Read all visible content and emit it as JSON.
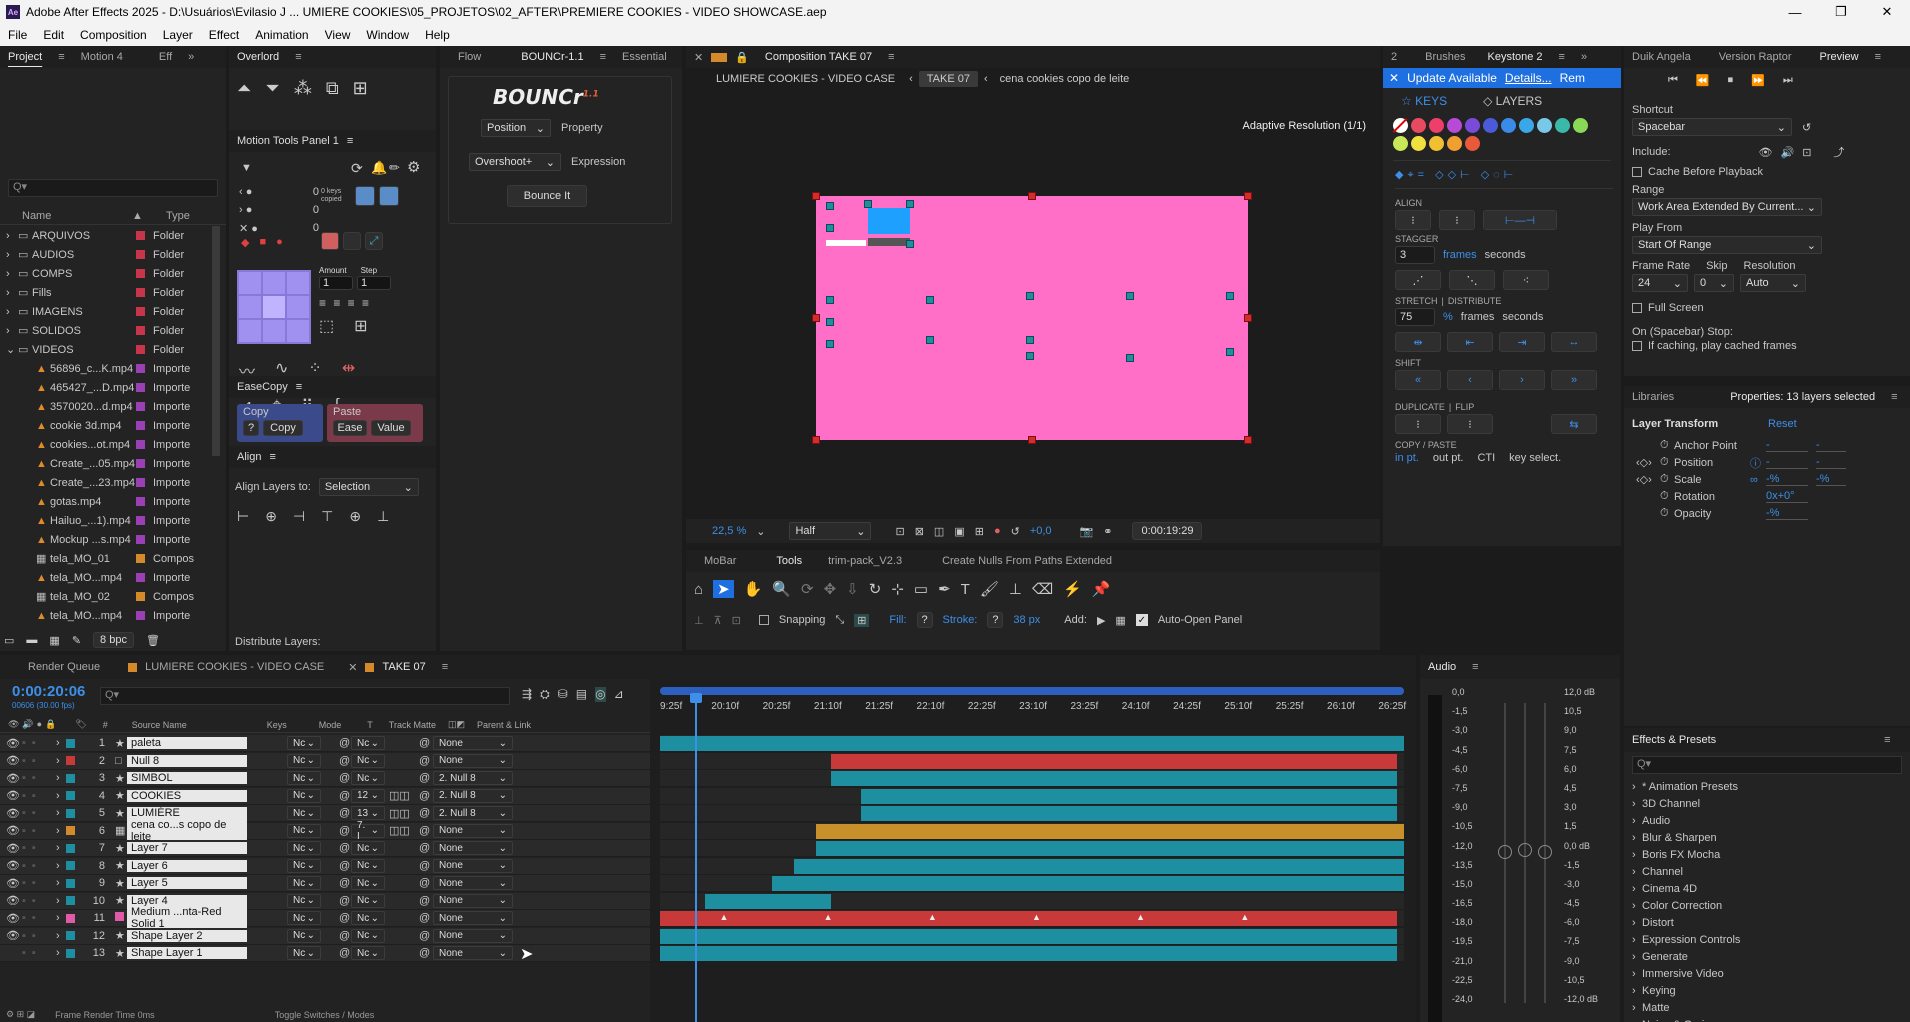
{
  "window": {
    "title": "Adobe After Effects 2025 - D:\\Usuários\\Evilasio J ... UMIERE COOKIES\\05_PROJETOS\\02_AFTER\\PREMIERE COOKIES - VIDEO SHOWCASE.aep",
    "app_badge": "Ae",
    "min": "—",
    "max": "❐",
    "close": "✕"
  },
  "menu": [
    "File",
    "Edit",
    "Composition",
    "Layer",
    "Effect",
    "Animation",
    "View",
    "Window",
    "Help"
  ],
  "project": {
    "tabs": [
      "Project",
      "Motion 4",
      "Eff"
    ],
    "search_placeholder": "Q▾",
    "columns": {
      "name": "Name",
      "type": "Type"
    },
    "bpc": "8 bpc",
    "items": [
      {
        "name": "ARQUIVOS",
        "type": "Folder",
        "color": "#c8344a",
        "kind": "folder"
      },
      {
        "name": "AUDIOS",
        "type": "Folder",
        "color": "#c8344a",
        "kind": "folder"
      },
      {
        "name": "COMPS",
        "type": "Folder",
        "color": "#c8344a",
        "kind": "folder"
      },
      {
        "name": "Fills",
        "type": "Folder",
        "color": "#c8344a",
        "kind": "folder"
      },
      {
        "name": "IMAGENS",
        "type": "Folder",
        "color": "#c8344a",
        "kind": "folder"
      },
      {
        "name": "SOLIDOS",
        "type": "Folder",
        "color": "#c8344a",
        "kind": "folder"
      },
      {
        "name": "VIDEOS",
        "type": "Folder",
        "color": "#c8344a",
        "kind": "folder-open"
      },
      {
        "name": "56896_c...K.mp4",
        "type": "Importe",
        "color": "#9b3fb5",
        "kind": "file"
      },
      {
        "name": "465427_...D.mp4",
        "type": "Importe",
        "color": "#9b3fb5",
        "kind": "file"
      },
      {
        "name": "3570020...d.mp4",
        "type": "Importe",
        "color": "#9b3fb5",
        "kind": "file"
      },
      {
        "name": "cookie 3d.mp4",
        "type": "Importe",
        "color": "#9b3fb5",
        "kind": "file"
      },
      {
        "name": "cookies...ot.mp4",
        "type": "Importe",
        "color": "#9b3fb5",
        "kind": "file"
      },
      {
        "name": "Create_...05.mp4",
        "type": "Importe",
        "color": "#9b3fb5",
        "kind": "file"
      },
      {
        "name": "Create_...23.mp4",
        "type": "Importe",
        "color": "#9b3fb5",
        "kind": "file"
      },
      {
        "name": "gotas.mp4",
        "type": "Importe",
        "color": "#9b3fb5",
        "kind": "file"
      },
      {
        "name": "Hailuo_...1).mp4",
        "type": "Importe",
        "color": "#9b3fb5",
        "kind": "file"
      },
      {
        "name": "Mockup ...s.mp4",
        "type": "Importe",
        "color": "#9b3fb5",
        "kind": "file"
      },
      {
        "name": "tela_MO_01",
        "type": "Compos",
        "color": "#d48a2a",
        "kind": "comp"
      },
      {
        "name": "tela_MO...mp4",
        "type": "Importe",
        "color": "#9b3fb5",
        "kind": "file"
      },
      {
        "name": "tela_MO_02",
        "type": "Compos",
        "color": "#d48a2a",
        "kind": "comp"
      },
      {
        "name": "tela_MO...mp4",
        "type": "Importe",
        "color": "#9b3fb5",
        "kind": "file"
      }
    ]
  },
  "overlord": {
    "tab": "Overlord"
  },
  "motiontools": {
    "tab": "Motion Tools Panel 1",
    "v1": "0",
    "v2": "0",
    "v3": "0",
    "keys_copied": "0 keys copied",
    "amount": "Amount",
    "step": "Step",
    "amount_v": "1",
    "step_v": "1"
  },
  "easecopy": {
    "tab": "EaseCopy",
    "copy": "Copy",
    "paste": "Paste",
    "q": "?",
    "copy_btn": "Copy",
    "ease": "Ease",
    "value": "Value"
  },
  "align": {
    "tab": "Align",
    "align_to": "Align Layers to:",
    "selection": "Selection",
    "distribute": "Distribute Layers:"
  },
  "bounce": {
    "tabs": [
      "Flow",
      "BOUNCr-1.1",
      "Essential"
    ],
    "logo": "BOUNCr",
    "ver": "1.1",
    "position": "Position",
    "property": "Property",
    "overshoot": "Overshoot+",
    "expression": "Expression",
    "bounce_it": "Bounce It"
  },
  "comp": {
    "tab": "Composition TAKE 07",
    "breadcrumbs": [
      "LUMIERE COOKIES - VIDEO CASE",
      "TAKE 07",
      "cena cookies copo de leite"
    ],
    "adaptive": "Adaptive Resolution (1/1)",
    "zoom": "22,5 %",
    "quality": "Half",
    "exposure": "+0,0",
    "timecode": "0:00:19:29"
  },
  "keystone": {
    "tabs": [
      "2",
      "Brushes",
      "Keystone 2"
    ],
    "update": "Update Available",
    "details": "Details...",
    "rem": "Rem",
    "keys": "KEYS",
    "layers": "LAYERS",
    "align": "ALIGN",
    "stagger": "STAGGER",
    "stagger_v": "3",
    "frames": "frames",
    "seconds": "seconds",
    "stretch": "STRETCH",
    "distribute": "DISTRIBUTE",
    "stretch_v": "75",
    "pct": "%",
    "shift": "SHIFT",
    "duplicate": "DUPLICATE",
    "flip": "FLIP",
    "copypaste": "COPY / PASTE",
    "inpt": "in pt.",
    "outpt": "out pt.",
    "cti": "CTI",
    "keysel": "key select.",
    "colors": [
      "#e84a5f",
      "#ee3e6a",
      "#b84ad8",
      "#7a4ad8",
      "#4a5ad8",
      "#3a8ae8",
      "#3aa8e8",
      "#7ac8e8",
      "#3ab8a8",
      "#8ad858",
      "#c8e858",
      "#f0e040",
      "#f0c030",
      "#f0a030",
      "#e85a3a"
    ]
  },
  "duik": {
    "tabs": [
      "Duik Angela",
      "Version Raptor",
      "Preview"
    ]
  },
  "preview": {
    "shortcut": "Shortcut",
    "shortcut_v": "Spacebar",
    "include": "Include:",
    "cache": "Cache Before Playback",
    "range": "Range",
    "range_v": "Work Area Extended By Current...",
    "playfrom": "Play From",
    "playfrom_v": "Start Of Range",
    "framerate": "Frame Rate",
    "skip": "Skip",
    "resolution": "Resolution",
    "fr_v": "24",
    "skip_v": "0",
    "res_v": "Auto",
    "fullscreen": "Full Screen",
    "stop": "On (Spacebar) Stop:",
    "ifcaching": "If caching, play cached frames"
  },
  "properties": {
    "tabs": [
      "Libraries",
      "Properties: 13 layers selected"
    ],
    "section": "Layer Transform",
    "reset": "Reset",
    "rows": [
      {
        "label": "Anchor Point",
        "v1": "-",
        "v2": "-"
      },
      {
        "label": "Position",
        "v1": "-",
        "v2": "-"
      },
      {
        "label": "Scale",
        "v1": "-%",
        "v2": "-%"
      },
      {
        "label": "Rotation",
        "v1": "0x+0°",
        "v2": ""
      },
      {
        "label": "Opacity",
        "v1": "-%",
        "v2": ""
      }
    ]
  },
  "tools": {
    "tabs": [
      "MoBar",
      "Tools",
      "trim-pack_V2.3",
      "Create Nulls From Paths Extended"
    ],
    "snapping": "Snapping",
    "fill": "Fill:",
    "stroke": "Stroke:",
    "q": "?",
    "stroke_px": "38 px",
    "add": "Add:",
    "autoopen": "Auto-Open Panel"
  },
  "timeline": {
    "tabs": [
      "Render Queue",
      "LUMIERE COOKIES - VIDEO CASE",
      "TAKE 07"
    ],
    "timecode": "0:00:20:06",
    "fps": "00606 (30.00 fps)",
    "search_placeholder": "Q▾",
    "headers": {
      "hash": "#",
      "source": "Source Name",
      "keys": "Keys",
      "mode": "Mode",
      "t": "T",
      "matte": "Track Matte",
      "parent": "Parent & Link"
    },
    "ruler": [
      "9:25f",
      "20:10f",
      "20:25f",
      "21:10f",
      "21:25f",
      "22:10f",
      "22:25f",
      "23:10f",
      "23:25f",
      "24:10f",
      "24:25f",
      "25:10f",
      "25:25f",
      "26:10f",
      "26:25f"
    ],
    "footer": {
      "frame_render": "Frame Render Time",
      "frame_render_v": "0ms",
      "toggle": "Toggle Switches / Modes"
    },
    "layers": [
      {
        "n": "1",
        "name": "paleta",
        "color": "#1e8fa0",
        "mode": "Nc",
        "matte": "Nc",
        "parent": "None",
        "type": "shape",
        "start": 0.0,
        "end": 1.0,
        "bar": "#1e8fa0"
      },
      {
        "n": "2",
        "name": "Null 8",
        "color": "#c83a3a",
        "mode": "Nc",
        "matte": "Nc",
        "parent": "None",
        "type": "null",
        "start": 0.23,
        "end": 0.99,
        "bar": "#c83a3a"
      },
      {
        "n": "3",
        "name": "SIMBOL",
        "color": "#1e8fa0",
        "mode": "Nc",
        "matte": "Nc",
        "parent": "2. Null 8",
        "type": "shape",
        "start": 0.23,
        "end": 0.99,
        "bar": "#1e8fa0"
      },
      {
        "n": "4",
        "name": "COOKIES",
        "color": "#1e8fa0",
        "mode": "Nc",
        "matte": "12",
        "parent": "2. Null 8",
        "type": "shape",
        "start": 0.27,
        "end": 0.99,
        "bar": "#1e8fa0"
      },
      {
        "n": "5",
        "name": "LUMIÉRE",
        "color": "#1e8fa0",
        "mode": "Nc",
        "matte": "13",
        "parent": "2. Null 8",
        "type": "shape",
        "start": 0.27,
        "end": 0.99,
        "bar": "#1e8fa0"
      },
      {
        "n": "6",
        "name": "cena co...s copo de leite",
        "color": "#d48a2a",
        "mode": "Nc",
        "matte": "7. I",
        "parent": "None",
        "type": "comp",
        "start": 0.21,
        "end": 1.0,
        "bar": "#c8902a"
      },
      {
        "n": "7",
        "name": "Layer 7",
        "color": "#1e8fa0",
        "mode": "Nc",
        "matte": "Nc",
        "parent": "None",
        "type": "shape",
        "start": 0.21,
        "end": 1.0,
        "bar": "#1e8fa0"
      },
      {
        "n": "8",
        "name": "Layer 6",
        "color": "#1e8fa0",
        "mode": "Nc",
        "matte": "Nc",
        "parent": "None",
        "type": "shape",
        "start": 0.18,
        "end": 1.0,
        "bar": "#1e8fa0"
      },
      {
        "n": "9",
        "name": "Layer 5",
        "color": "#1e8fa0",
        "mode": "Nc",
        "matte": "Nc",
        "parent": "None",
        "type": "shape",
        "start": 0.15,
        "end": 1.0,
        "bar": "#1e8fa0"
      },
      {
        "n": "10",
        "name": "Layer 4",
        "color": "#1e8fa0",
        "mode": "Nc",
        "matte": "Nc",
        "parent": "None",
        "type": "shape",
        "start": 0.06,
        "end": 0.23,
        "bar": "#1e8fa0"
      },
      {
        "n": "11",
        "name": "Medium ...nta-Red Solid 1",
        "color": "#e05aa8",
        "mode": "Nc",
        "matte": "Nc",
        "parent": "None",
        "type": "solid",
        "start": 0.0,
        "end": 0.99,
        "bar": "#c83a3a"
      },
      {
        "n": "12",
        "name": "Shape Layer 2",
        "color": "#1e8fa0",
        "mode": "Nc",
        "matte": "Nc",
        "parent": "None",
        "type": "shape",
        "start": 0.0,
        "end": 0.99,
        "bar": "#1e8fa0"
      },
      {
        "n": "13",
        "name": "Shape Layer 1",
        "color": "#1e8fa0",
        "mode": "Nc",
        "matte": "Nc",
        "parent": "None",
        "type": "shape",
        "start": 0.0,
        "end": 0.99,
        "bar": "#1e8fa0"
      }
    ]
  },
  "audio": {
    "tab": "Audio",
    "left": [
      "0,0",
      "-1,5",
      "-3,0",
      "-4,5",
      "-6,0",
      "-7,5",
      "-9,0",
      "-10,5",
      "-12,0",
      "-13,5",
      "-15,0",
      "-16,5",
      "-18,0",
      "-19,5",
      "-21,0",
      "-22,5",
      "-24,0"
    ],
    "right": [
      "12,0 dB",
      "10,5",
      "9,0",
      "7,5",
      "6,0",
      "4,5",
      "3,0",
      "1,5",
      "0,0 dB",
      "-1,5",
      "-3,0",
      "-4,5",
      "-6,0",
      "-7,5",
      "-9,0",
      "-10,5",
      "-12,0 dB"
    ]
  },
  "effects": {
    "tab": "Effects & Presets",
    "search": "Q▾",
    "items": [
      "* Animation Presets",
      "3D Channel",
      "Audio",
      "Blur & Sharpen",
      "Boris FX Mocha",
      "Channel",
      "Cinema 4D",
      "Color Correction",
      "Distort",
      "Expression Controls",
      "Generate",
      "Immersive Video",
      "Keying",
      "Matte",
      "Noise & Grain"
    ]
  }
}
